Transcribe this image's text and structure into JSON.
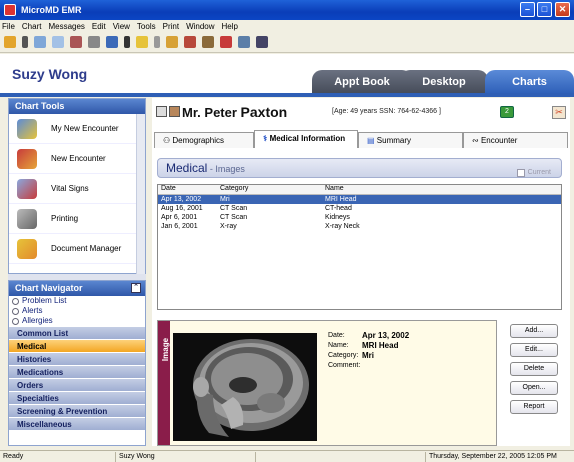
{
  "window": {
    "title": "MicroMD EMR"
  },
  "menu": [
    "File",
    "Chart",
    "Messages",
    "Edit",
    "View",
    "Tools",
    "Print",
    "Window",
    "Help"
  ],
  "header": {
    "user_name": "Suzy Wong",
    "tabs": [
      "Appt Book",
      "Desktop",
      "Charts"
    ]
  },
  "chart_tools": {
    "title": "Chart Tools",
    "items": [
      "My New Encounter",
      "New Encounter",
      "Vital Signs",
      "Printing",
      "Document Manager"
    ]
  },
  "chart_navigator": {
    "title": "Chart Navigator",
    "links": [
      "Problem List",
      "Alerts",
      "Allergies"
    ],
    "sections": [
      "Common List",
      "Medical",
      "Histories",
      "Medications",
      "Orders",
      "Specialties",
      "Screening & Prevention",
      "Miscellaneous"
    ],
    "active_section": "Medical"
  },
  "patient": {
    "first": "Mr. Peter",
    "last": "Paxton",
    "info": "[Age: 49 years SSN: 764-62-4366 ]",
    "badge": "2"
  },
  "subtabs": [
    "Demographics",
    "Medical Information",
    "Summary",
    "Encounter"
  ],
  "medical": {
    "title": "Medical",
    "subtitle": " - Images",
    "current_label": "Current"
  },
  "list": {
    "columns": [
      "Date",
      "Category",
      "Name"
    ],
    "rows": [
      [
        "Apr 13, 2002",
        "Mri",
        "MRI Head"
      ],
      [
        "Aug 16, 2001",
        "CT Scan",
        "CT-head"
      ],
      [
        "Apr 6, 2001",
        "CT Scan",
        "Kidneys"
      ],
      [
        "Jan 6, 2001",
        "X-ray",
        "X-ray Neck"
      ]
    ]
  },
  "detail": {
    "side_label": "Image",
    "fields": [
      {
        "label": "Date:",
        "value": "Apr 13, 2002"
      },
      {
        "label": "Name:",
        "value": "MRI Head"
      },
      {
        "label": "Category:",
        "value": "Mri"
      },
      {
        "label": "Comment:",
        "value": ""
      }
    ]
  },
  "buttons": [
    "Add...",
    "Edit...",
    "Delete",
    "Open...",
    "Report"
  ],
  "status": {
    "left": "Ready",
    "user": "Suzy Wong",
    "datetime": "Thursday, September 22, 2005 12:05 PM"
  },
  "colors": {
    "accent": "#2f5fb5",
    "active_section": "#f3a623",
    "selected_row": "#3a65b4",
    "image_label": "#8a1d4a"
  }
}
